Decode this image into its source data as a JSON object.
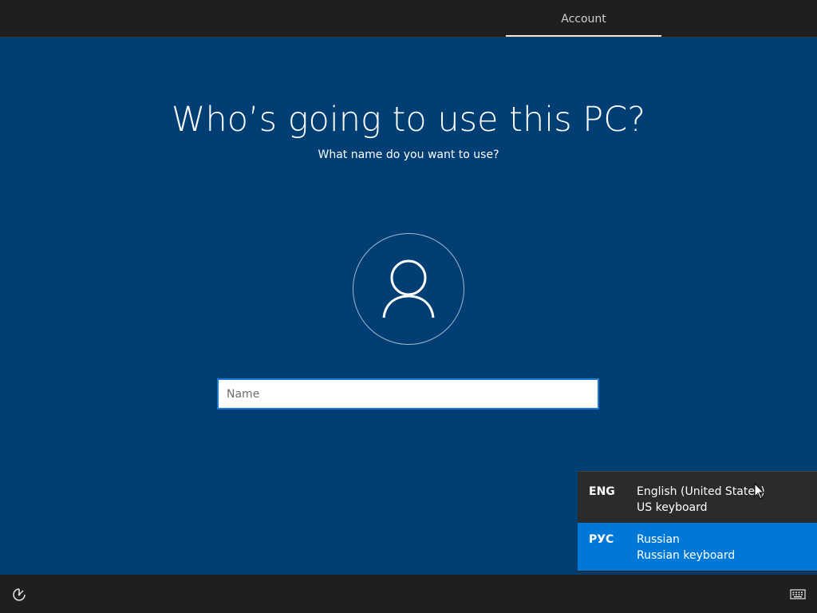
{
  "header": {
    "tab_account": "Account"
  },
  "main": {
    "title": "Who’s going to use this PC?",
    "subtitle": "What name do you want to use?",
    "avatar_icon": "user-icon",
    "name_input": {
      "placeholder": "Name",
      "value": ""
    }
  },
  "language_menu": {
    "items": [
      {
        "code": "ENG",
        "language": "English (United States)",
        "keyboard": "US keyboard",
        "selected": false
      },
      {
        "code": "РУС",
        "language": "Russian",
        "keyboard": "Russian keyboard",
        "selected": true
      }
    ]
  },
  "footer": {
    "ease_of_access_icon": "ease-of-access-icon",
    "keyboard_icon": "keyboard-icon"
  },
  "colors": {
    "background": "#003e74",
    "accent": "#0078d7",
    "topbar": "#1f1f1f",
    "menu": "#2b2b2b"
  }
}
